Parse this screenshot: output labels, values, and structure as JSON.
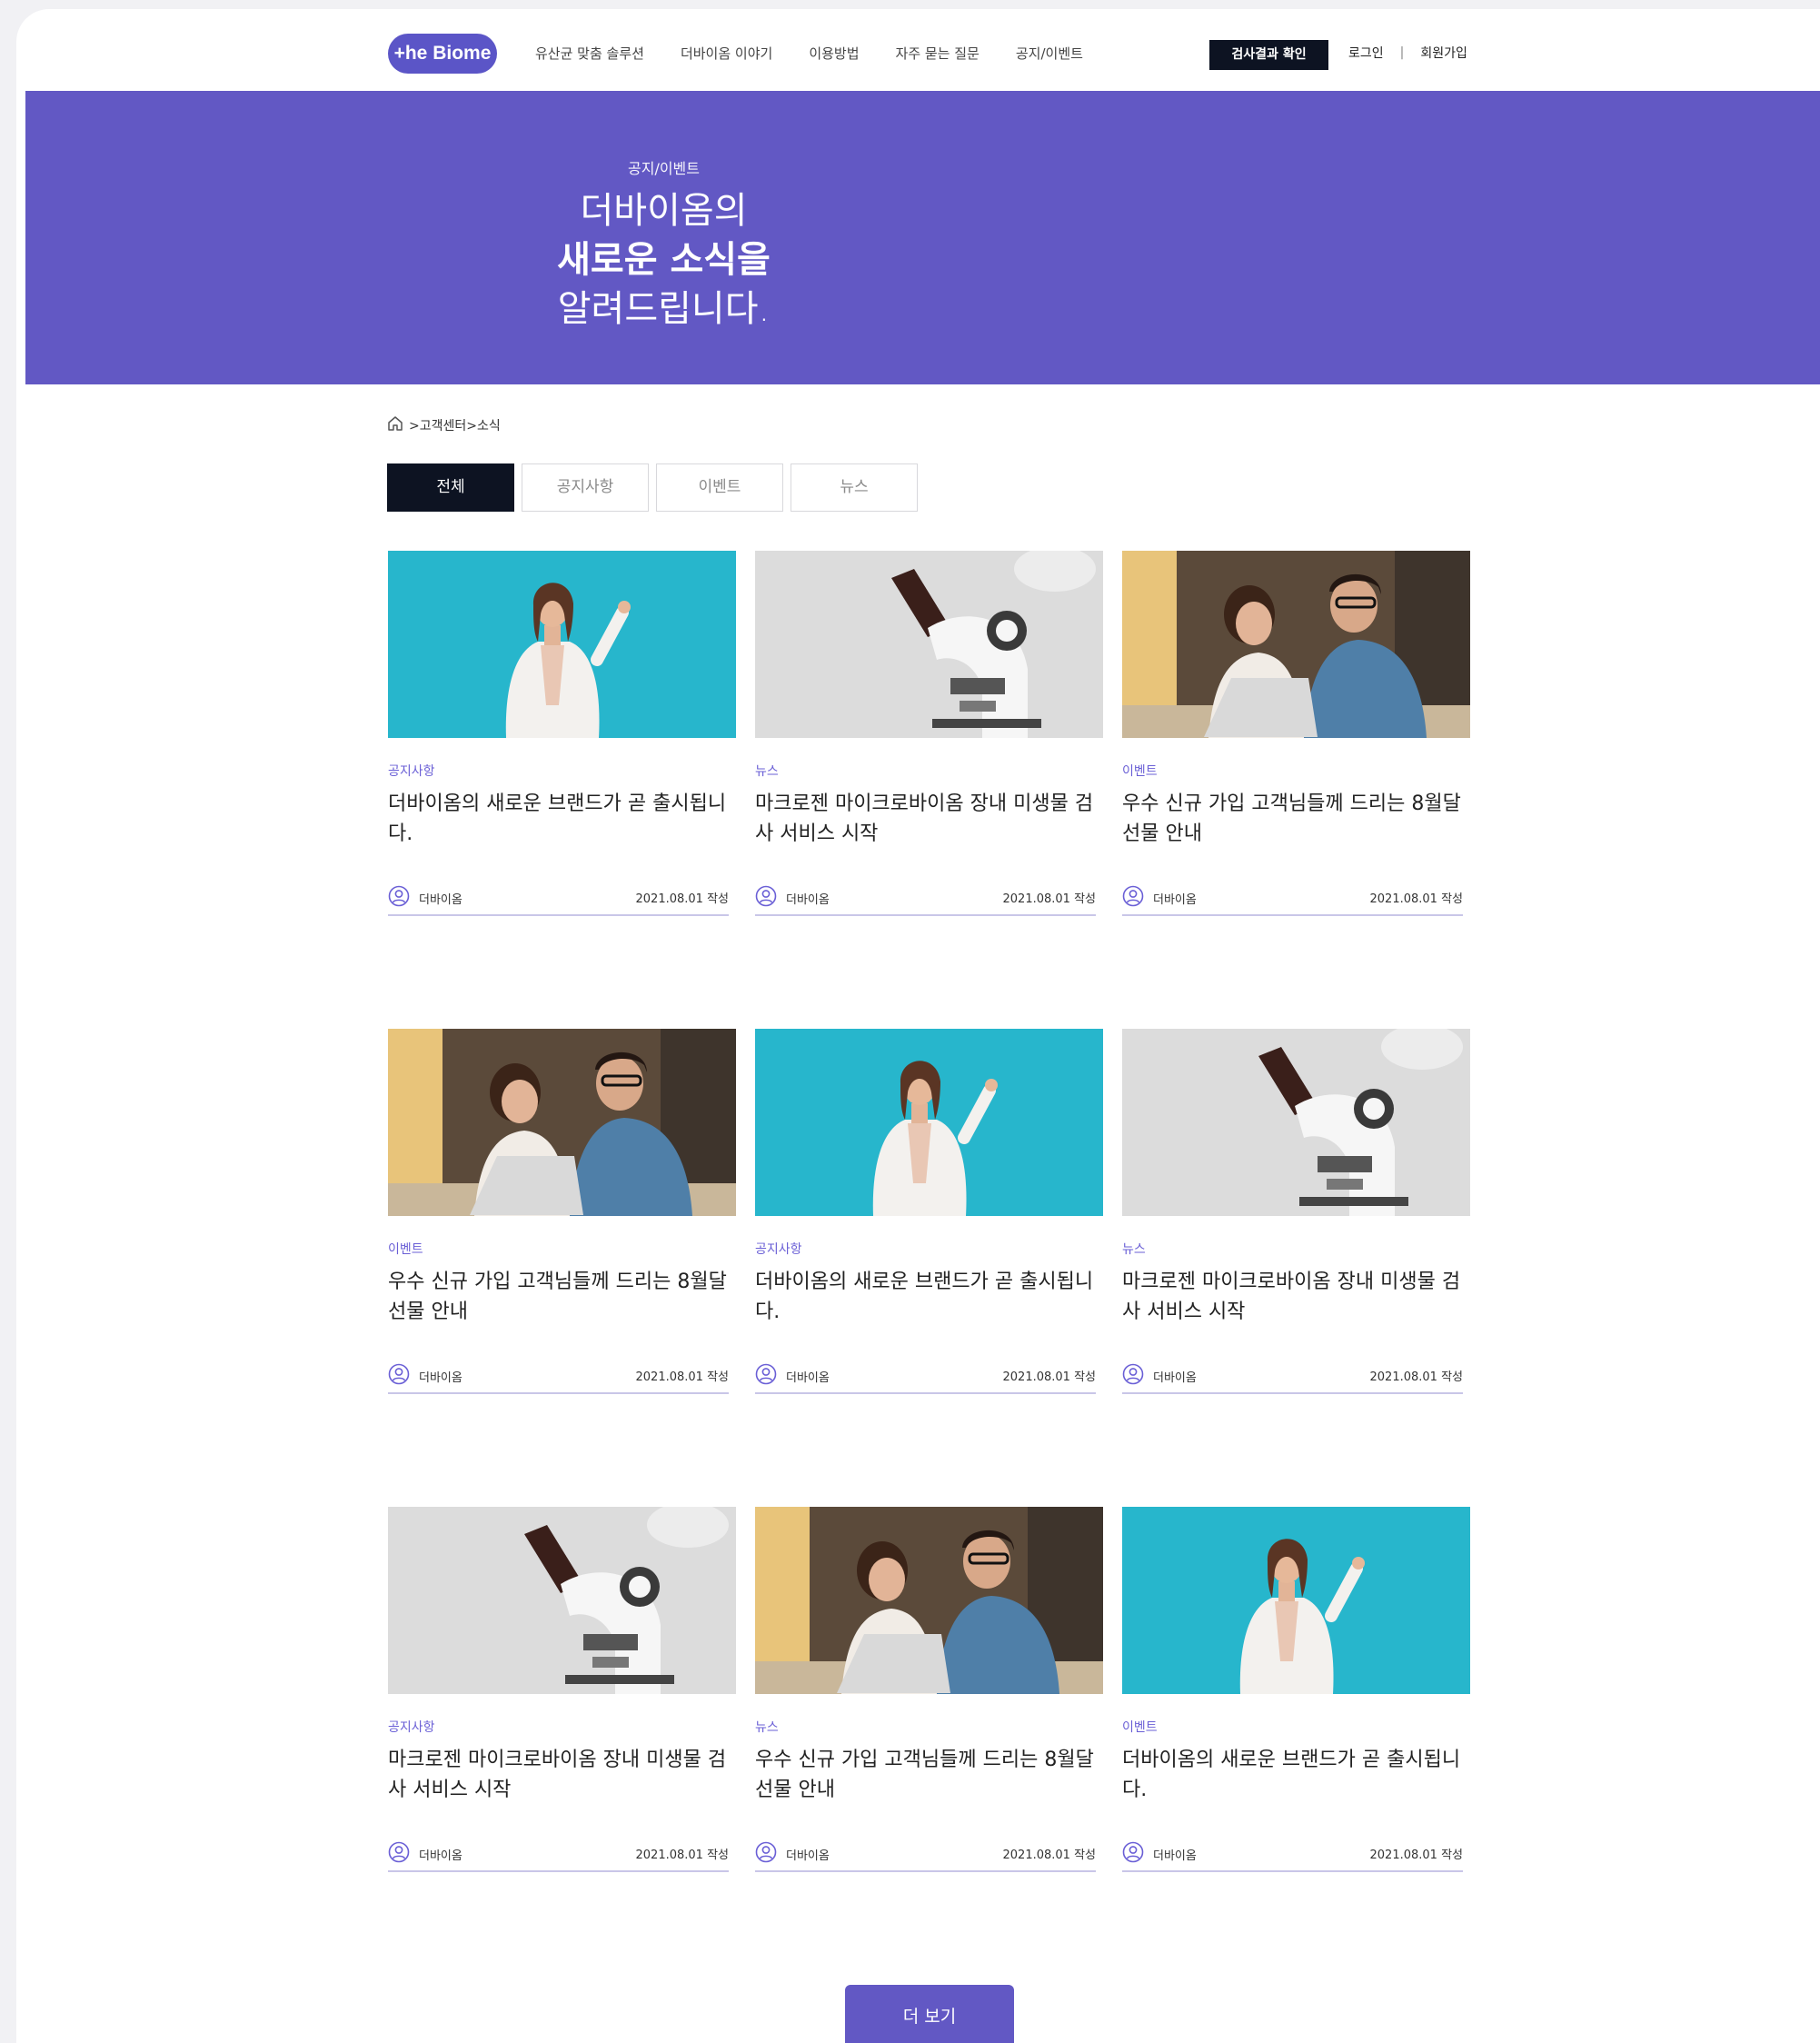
{
  "header": {
    "logo_text": "+he Biome",
    "nav": [
      "유산균 맞춤 솔루션",
      "더바이옴 이야기",
      "이용방법",
      "자주 묻는 질문",
      "공지/이벤트"
    ],
    "result_button": "검사결과 확인",
    "login": "로그인",
    "separator": "|",
    "signup": "회원가입"
  },
  "hero": {
    "eyebrow": "공지/이벤트",
    "line1": "더바이옴의",
    "line2": "새로운 소식을",
    "line3": "알려드립니다."
  },
  "breadcrumb": ">고객센터>소식",
  "tabs": [
    "전체",
    "공지사항",
    "이벤트",
    "뉴스"
  ],
  "cards": [
    {
      "category": "공지사항",
      "title": "더바이옴의 새로운 브랜드가 곧 출시됩니다.",
      "author": "더바이옴",
      "date": "2021.08.01 작성",
      "image": "woman-pointing"
    },
    {
      "category": "뉴스",
      "title": "마크로젠 마이크로바이옴 장내 미생물 검사 서비스 시작",
      "author": "더바이옴",
      "date": "2021.08.01 작성",
      "image": "microscope"
    },
    {
      "category": "이벤트",
      "title": "우수 신규 가입 고객님들께 드리는 8월달 선물 안내",
      "author": "더바이옴",
      "date": "2021.08.01 작성",
      "image": "couple-laptop"
    },
    {
      "category": "이벤트",
      "title": "우수 신규 가입 고객님들께 드리는 8월달 선물 안내",
      "author": "더바이옴",
      "date": "2021.08.01 작성",
      "image": "couple-laptop"
    },
    {
      "category": "공지사항",
      "title": "더바이옴의 새로운 브랜드가 곧 출시됩니다.",
      "author": "더바이옴",
      "date": "2021.08.01 작성",
      "image": "woman-pointing"
    },
    {
      "category": "뉴스",
      "title": "마크로젠 마이크로바이옴 장내 미생물 검사 서비스 시작",
      "author": "더바이옴",
      "date": "2021.08.01 작성",
      "image": "microscope"
    },
    {
      "category": "공지사항",
      "title": "마크로젠 마이크로바이옴 장내 미생물 검사 서비스 시작",
      "author": "더바이옴",
      "date": "2021.08.01 작성",
      "image": "microscope"
    },
    {
      "category": "뉴스",
      "title": "우수 신규 가입 고객님들께 드리는 8월달 선물 안내",
      "author": "더바이옴",
      "date": "2021.08.01 작성",
      "image": "couple-laptop"
    },
    {
      "category": "이벤트",
      "title": "더바이옴의 새로운 브랜드가 곧 출시됩니다.",
      "author": "더바이옴",
      "date": "2021.08.01 작성",
      "image": "woman-pointing"
    }
  ],
  "more_button": "더 보기",
  "colors": {
    "accent": "#6258c4",
    "dark": "#0d1322",
    "category": "#6a5fd6"
  }
}
